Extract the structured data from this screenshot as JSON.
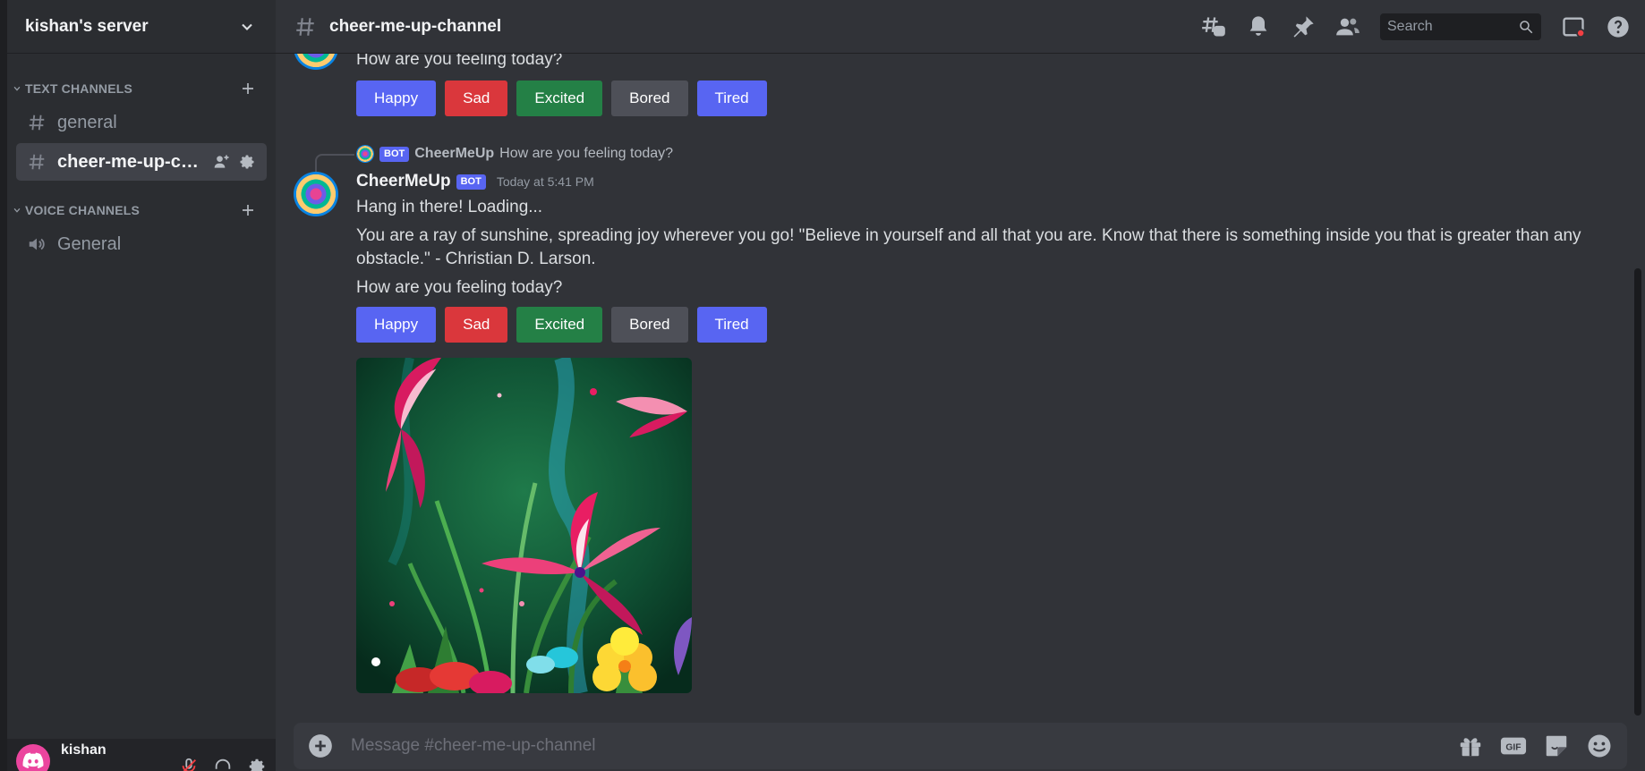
{
  "server": {
    "name": "kishan's server"
  },
  "categories": {
    "text": "TEXT CHANNELS",
    "voice": "VOICE CHANNELS"
  },
  "channels": {
    "text": [
      {
        "label": "general"
      },
      {
        "label": "cheer-me-up-cha..."
      }
    ],
    "voice": [
      {
        "label": "General"
      }
    ]
  },
  "user": {
    "name": "kishan"
  },
  "topbar": {
    "channel_name": "cheer-me-up-channel",
    "search_placeholder": "Search"
  },
  "messages": {
    "previous": {
      "question": "How are you feeling today?",
      "buttons": [
        "Happy",
        "Sad",
        "Excited",
        "Bored",
        "Tired"
      ]
    },
    "current": {
      "reply_author": "CheerMeUp",
      "reply_bot_tag": "BOT",
      "reply_text": "How are you feeling today?",
      "author": "CheerMeUp",
      "bot_tag": "BOT",
      "timestamp": "Today at 5:41 PM",
      "line1": "Hang in there! Loading...",
      "line2": "You are a ray of sunshine, spreading joy wherever you go! \"Believe in yourself and all that you are. Know that there is something inside you that is greater than any obstacle.\" - Christian D. Larson.",
      "question": "How are you feeling today?",
      "buttons": [
        "Happy",
        "Sad",
        "Excited",
        "Bored",
        "Tired"
      ]
    }
  },
  "composer": {
    "placeholder": "Message #cheer-me-up-channel",
    "gif_label": "GIF"
  },
  "colors": {
    "blurple": "#5865f2",
    "danger": "#da373c",
    "success": "#248046",
    "secondary": "#4e5058",
    "background": "#313338"
  }
}
